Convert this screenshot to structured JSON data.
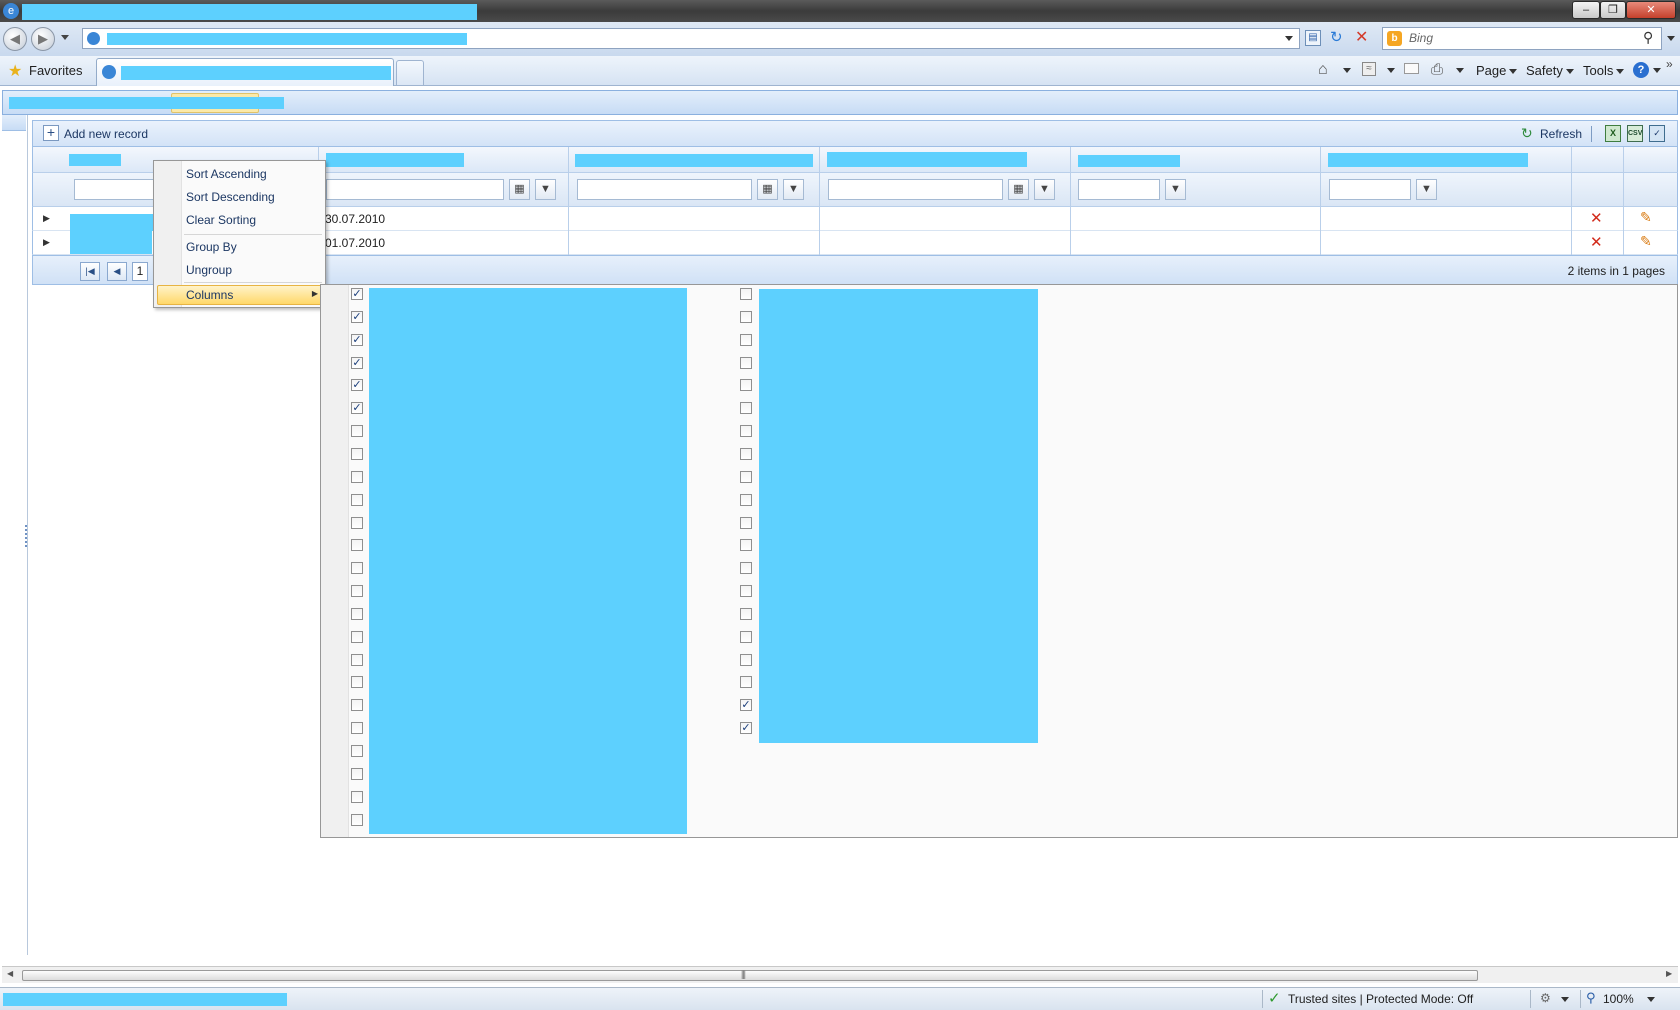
{
  "browser": {
    "search_placeholder": "Bing",
    "favorites_label": "Favorites",
    "commands": {
      "page": "Page",
      "safety": "Safety",
      "tools": "Tools"
    }
  },
  "grid": {
    "toolbar": {
      "add_label": "Add new record",
      "refresh_label": "Refresh"
    },
    "rows": [
      {
        "date": "30.07.2010"
      },
      {
        "date": "01.07.2010"
      }
    ],
    "pager": {
      "current_page": "1",
      "summary": "2 items in 1 pages"
    }
  },
  "context_menu": {
    "items": [
      "Sort Ascending",
      "Sort Descending",
      "Clear Sorting",
      "Group By",
      "Ungroup",
      "Columns"
    ]
  },
  "columns_submenu": {
    "left_checked": [
      true,
      true,
      true,
      true,
      true,
      true,
      false,
      false,
      false,
      false,
      false,
      false,
      false,
      false,
      false,
      false,
      false,
      false,
      false,
      false,
      false,
      false,
      false,
      false
    ],
    "right_checked": [
      false,
      false,
      false,
      false,
      false,
      false,
      false,
      false,
      false,
      false,
      false,
      false,
      false,
      false,
      false,
      false,
      false,
      false,
      true,
      true
    ]
  },
  "statusbar": {
    "security_zone": "Trusted sites | Protected Mode: Off",
    "zoom": "100%"
  }
}
